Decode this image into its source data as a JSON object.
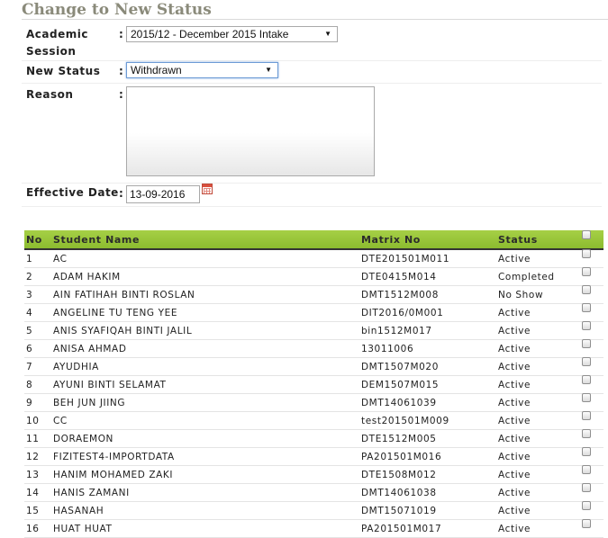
{
  "title": "Change to New Status",
  "form": {
    "academic_session_label": "Academic Session",
    "academic_session_value": "2015/12 - December 2015 Intake",
    "new_status_label": "New Status",
    "new_status_value": "Withdrawn",
    "reason_label": "Reason",
    "reason_value": "",
    "effective_date_label": "Effective Date",
    "effective_date_value": "13-09-2016",
    "colon": ":"
  },
  "table": {
    "headers": {
      "no": "No",
      "name": "Student Name",
      "matrix": "Matrix No",
      "status": "Status"
    },
    "rows": [
      {
        "no": "1",
        "name": "AC",
        "matrix": "DTE201501M011",
        "status": "Active"
      },
      {
        "no": "2",
        "name": "ADAM HAKIM",
        "matrix": "DTE0415M014",
        "status": "Completed"
      },
      {
        "no": "3",
        "name": "AIN FATIHAH BINTI ROSLAN",
        "matrix": "DMT1512M008",
        "status": "No Show"
      },
      {
        "no": "4",
        "name": "ANGELINE TU TENG YEE",
        "matrix": "DIT2016/0M001",
        "status": "Active"
      },
      {
        "no": "5",
        "name": "ANIS SYAFIQAH BINTI JALIL",
        "matrix": "bin1512M017",
        "status": "Active"
      },
      {
        "no": "6",
        "name": "ANISA AHMAD",
        "matrix": "13011006",
        "status": "Active"
      },
      {
        "no": "7",
        "name": "AYUDHIA",
        "matrix": "DMT1507M020",
        "status": "Active"
      },
      {
        "no": "8",
        "name": "AYUNI BINTI SELAMAT",
        "matrix": "DEM1507M015",
        "status": "Active"
      },
      {
        "no": "9",
        "name": "BEH JUN JIING",
        "matrix": "DMT14061039",
        "status": "Active"
      },
      {
        "no": "10",
        "name": "CC",
        "matrix": "test201501M009",
        "status": "Active"
      },
      {
        "no": "11",
        "name": "DORAEMON",
        "matrix": "DTE1512M005",
        "status": "Active"
      },
      {
        "no": "12",
        "name": "FIZITEST4-IMPORTDATA",
        "matrix": "PA201501M016",
        "status": "Active"
      },
      {
        "no": "13",
        "name": "HANIM MOHAMED ZAKI",
        "matrix": "DTE1508M012",
        "status": "Active"
      },
      {
        "no": "14",
        "name": "HANIS ZAMANI",
        "matrix": "DMT14061038",
        "status": "Active"
      },
      {
        "no": "15",
        "name": "HASANAH",
        "matrix": "DMT15071019",
        "status": "Active"
      },
      {
        "no": "16",
        "name": "HUAT HUAT",
        "matrix": "PA201501M017",
        "status": "Active"
      }
    ]
  },
  "colors": {
    "header_green": "#9bc93c",
    "title_gray": "#8a8a7a"
  }
}
